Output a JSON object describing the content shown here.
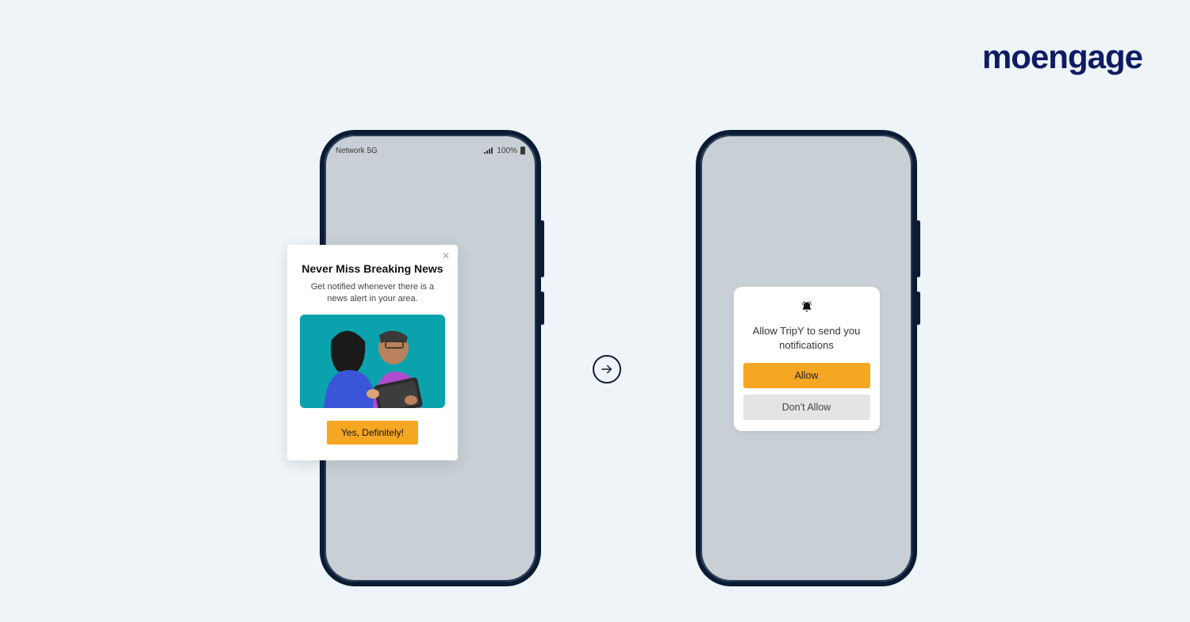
{
  "brand": "moengage",
  "statusbar": {
    "network": "Network 5G",
    "battery": "100%"
  },
  "card1": {
    "title": "Never Miss Breaking News",
    "subtitle": "Get notified whenever there is a news alert in your area.",
    "cta": "Yes, Definitely!",
    "close": "✕"
  },
  "card2": {
    "message": "Allow TripY to send you notifications",
    "allow": "Allow",
    "deny": "Don't Allow"
  },
  "icons": {
    "bell": "bell-icon",
    "signal": "signal-icon",
    "battery": "battery-icon",
    "arrow": "arrow-right-circle-icon",
    "close": "close-icon"
  },
  "colors": {
    "background": "#eef4f7",
    "brand": "#0f1b63",
    "accent": "#f5a623",
    "phone_frame": "#0b1b33",
    "phone_screen": "#c8d0d5"
  }
}
